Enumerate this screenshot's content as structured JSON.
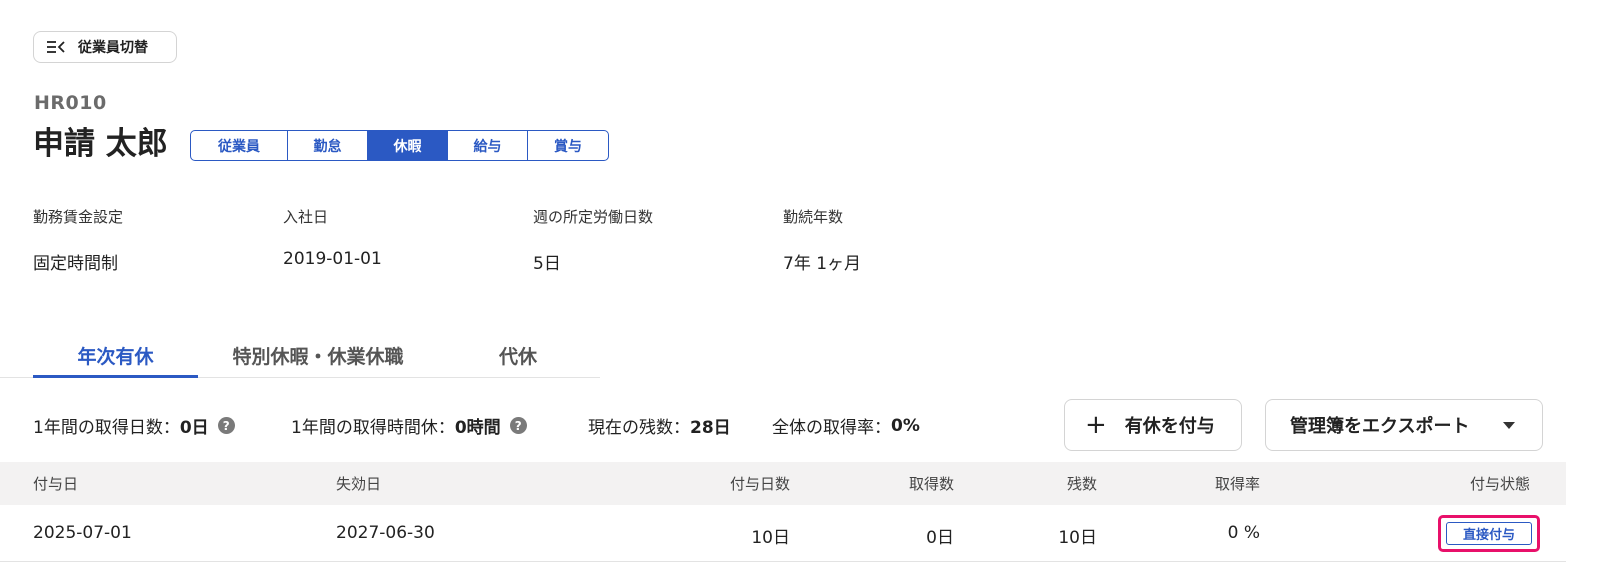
{
  "header": {
    "switch_label": "従業員切替",
    "employee_code": "HR010",
    "employee_name": "申請 太郎",
    "section_tabs": [
      "従業員",
      "勤怠",
      "休暇",
      "給与",
      "賞与"
    ],
    "active_section": "休暇"
  },
  "info": [
    {
      "label": "勤務賃金設定",
      "value": "固定時間制"
    },
    {
      "label": "入社日",
      "value": "2019-01-01"
    },
    {
      "label": "週の所定労働日数",
      "value": "5日"
    },
    {
      "label": "勤続年数",
      "value": "7年 1ヶ月"
    }
  ],
  "leave_tabs": [
    "年次有休",
    "特別休暇・休業休職",
    "代休"
  ],
  "active_leave_tab": "年次有休",
  "summary": {
    "annual_days_label": "1年間の取得日数：",
    "annual_days_value": "0日",
    "annual_hours_label": "1年間の取得時間休：",
    "annual_hours_value": "0時間",
    "remaining_label": "現在の残数：",
    "remaining_value": "28日",
    "rate_label": "全体の取得率：",
    "rate_value": "0%"
  },
  "actions": {
    "grant_label": "有休を付与",
    "export_label": "管理簿をエクスポート"
  },
  "table": {
    "columns": [
      "付与日",
      "失効日",
      "付与日数",
      "取得数",
      "残数",
      "取得率",
      "付与状態"
    ],
    "rows": [
      [
        "2025-07-01",
        "2027-06-30",
        "10日",
        "0日",
        "10日",
        "0 %",
        "直接付与"
      ]
    ]
  },
  "colors": {
    "accent": "#2b59c3",
    "highlight": "#e8106a"
  }
}
